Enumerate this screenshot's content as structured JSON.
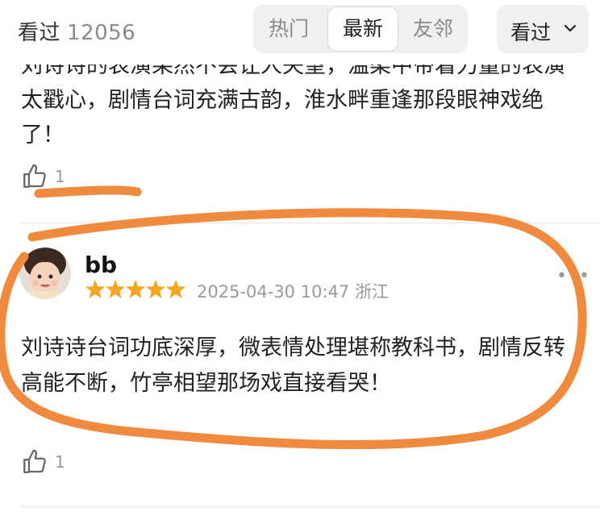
{
  "header": {
    "title": "看过",
    "count": "12056",
    "tabs": [
      "热门",
      "最新",
      "友邻"
    ],
    "active_tab": "最新",
    "dropdown_label": "看过"
  },
  "previous_comment": {
    "text": "刘诗诗的表演果然不会让人失望，温柔中带着力量的表演太戳心，剧情台词充满古韵，淮水畔重逢那段眼神戏绝了！",
    "likes": "1"
  },
  "review": {
    "username": "bb",
    "rating": 5,
    "date": "2025-04-30 10:47",
    "location": "浙江",
    "text": "刘诗诗台词功底深厚，微表情处理堪称教科书，剧情反转高能不断，竹亭相望那场戏直接看哭！",
    "likes": "1"
  },
  "colors": {
    "star": "#f5a623",
    "annotation_stroke": "#f08a3e",
    "muted_text": "#9a9a9a",
    "segment_bg": "#f0f0f2"
  },
  "icons": [
    "thumbs-up-icon",
    "star-icon",
    "chevron-down-icon",
    "more-dots-icon"
  ]
}
